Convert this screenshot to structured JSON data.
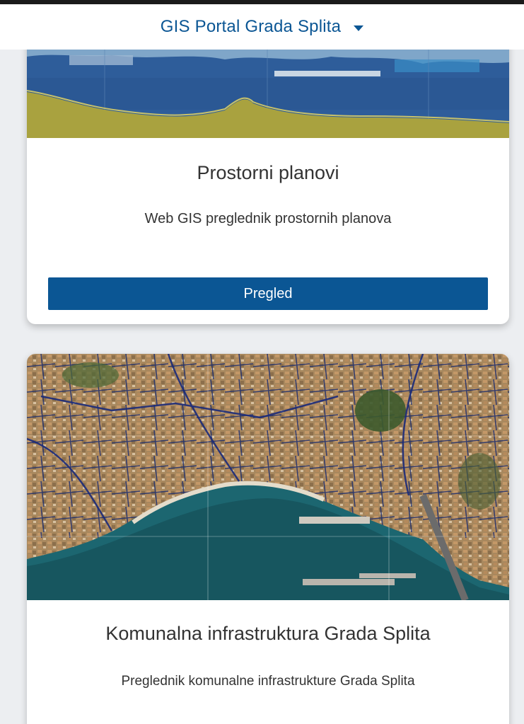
{
  "header": {
    "title": "GIS Portal Grada Splita",
    "dropdown_icon": "caret-down-icon",
    "color": "#0b5694"
  },
  "cards": [
    {
      "title": "Prostorni planovi",
      "description": "Web GIS preglednik prostornih planova",
      "button_label": "Pregled",
      "image_icon": "spatial-plan-map-thumbnail"
    },
    {
      "title": "Komunalna infrastruktura Grada Splita",
      "description": "Preglednik komunalne infrastrukture Grada Splita",
      "image_icon": "aerial-infrastructure-map-thumbnail"
    }
  ],
  "colors": {
    "accent": "#0b5694",
    "page_background": "#eceef1",
    "card_background": "#ffffff"
  }
}
